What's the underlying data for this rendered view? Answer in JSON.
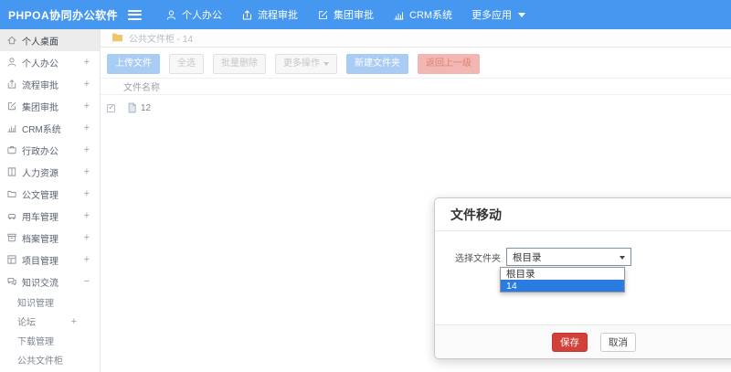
{
  "topbar": {
    "logo": "PHPOA协同办公软件",
    "nav": [
      {
        "label": "个人办公",
        "icon": "user-icon"
      },
      {
        "label": "流程审批",
        "icon": "upload-icon"
      },
      {
        "label": "集团审批",
        "icon": "edit-icon"
      },
      {
        "label": "CRM系统",
        "icon": "chart-icon"
      },
      {
        "label": "更多应用",
        "icon": "caret-down-icon"
      }
    ]
  },
  "sidebar": {
    "items": [
      {
        "label": "个人桌面",
        "icon": "home-icon",
        "expand": "",
        "active": true
      },
      {
        "label": "个人办公",
        "icon": "user-icon",
        "expand": "+"
      },
      {
        "label": "流程审批",
        "icon": "upload-icon",
        "expand": "+"
      },
      {
        "label": "集团审批",
        "icon": "edit-icon",
        "expand": "+"
      },
      {
        "label": "CRM系统",
        "icon": "chart-icon",
        "expand": "+"
      },
      {
        "label": "行政办公",
        "icon": "briefcase-icon",
        "expand": "+"
      },
      {
        "label": "人力资源",
        "icon": "book-icon",
        "expand": "+"
      },
      {
        "label": "公文管理",
        "icon": "folder-icon",
        "expand": "+"
      },
      {
        "label": "用车管理",
        "icon": "car-icon",
        "expand": "+"
      },
      {
        "label": "档案管理",
        "icon": "archive-icon",
        "expand": "+"
      },
      {
        "label": "项目管理",
        "icon": "project-icon",
        "expand": "+"
      },
      {
        "label": "知识交流",
        "icon": "chat-icon",
        "expand": "−"
      }
    ],
    "subitems": [
      {
        "label": "知识管理",
        "expand": ""
      },
      {
        "label": "论坛",
        "expand": "+"
      },
      {
        "label": "下载管理",
        "expand": ""
      },
      {
        "label": "公共文件柜",
        "expand": ""
      }
    ]
  },
  "main": {
    "breadcrumb": "公共文件柜 - 14",
    "toolbar": {
      "upload": "上传文件",
      "select_all": "全选",
      "batch_delete": "批量删除",
      "more_actions": "更多操作",
      "new_folder": "新建文件夹",
      "go_back": "返回上一级"
    },
    "table": {
      "header": "文件名称",
      "rows": [
        {
          "name": "12",
          "checked": true
        }
      ]
    }
  },
  "modal": {
    "title": "文件移动",
    "label": "选择文件夹",
    "select_value": "根目录",
    "options": [
      {
        "label": "根目录",
        "selected": false
      },
      {
        "label": "14",
        "selected": true
      }
    ],
    "save": "保存",
    "cancel": "取消"
  },
  "colors": {
    "topbar_blue": "#4697f0",
    "button_light_blue": "#a9ccf4",
    "button_pink": "#f2b7b2",
    "save_red": "#d2403a",
    "option_highlight_blue": "#2a7ce0",
    "folder_orange": "#f0c36d"
  }
}
